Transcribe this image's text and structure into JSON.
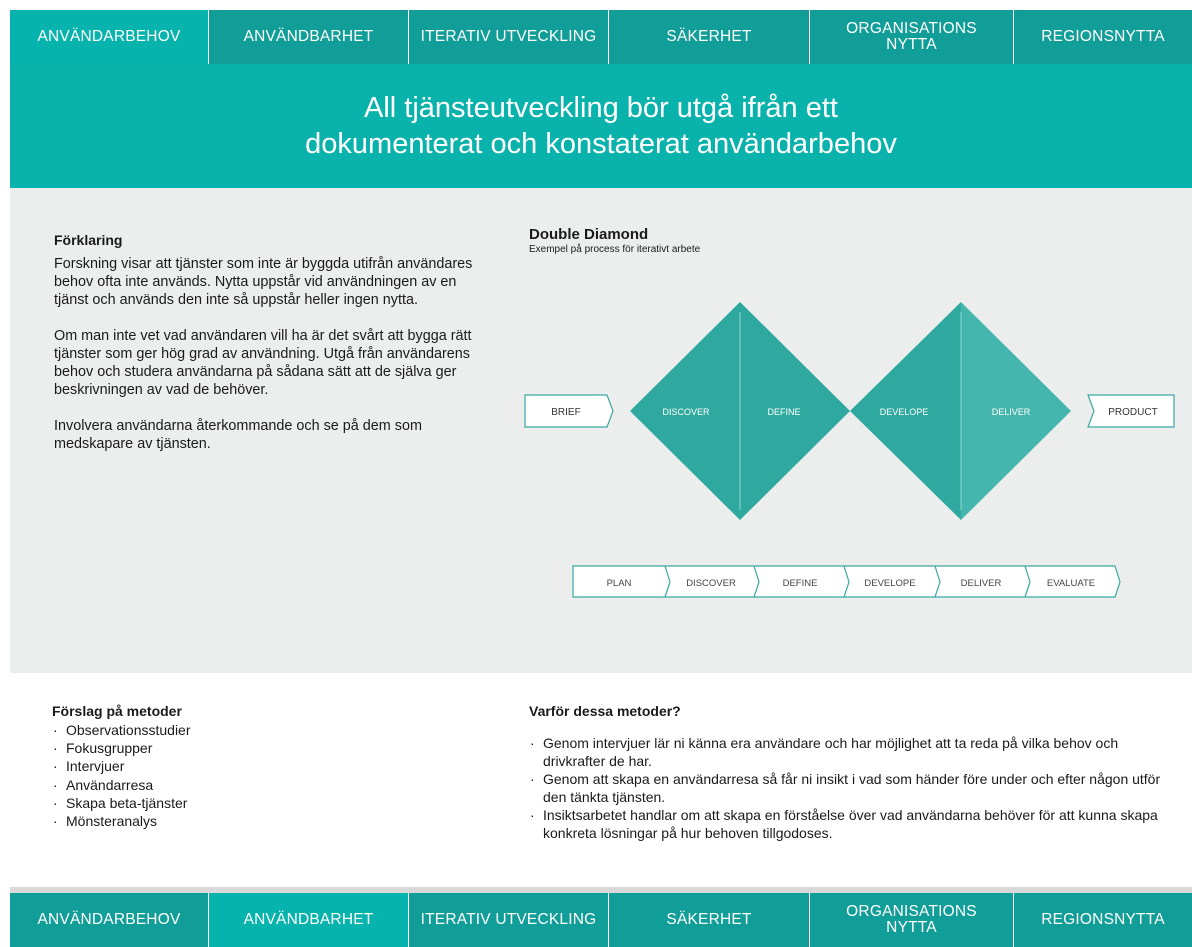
{
  "nav_top": [
    {
      "label": "ANVÄNDARBEHOV",
      "lines": [
        "ANVÄNDARBEHOV"
      ]
    },
    {
      "label": "ANVÄNDBARHET",
      "lines": [
        "ANVÄNDBARHET"
      ]
    },
    {
      "label": "ITERATIV UTVECKLING",
      "lines": [
        "ITERATIV UTVECKLING"
      ]
    },
    {
      "label": "SÄKERHET",
      "lines": [
        "SÄKERHET"
      ]
    },
    {
      "label": "ORGANISATIONS NYTTA",
      "lines": [
        "ORGANISATIONS",
        "NYTTA"
      ]
    },
    {
      "label": "REGIONSNYTTA",
      "lines": [
        "REGIONSNYTTA"
      ]
    }
  ],
  "hero": {
    "line1": "All tjänsteutveckling bör utgå ifrån ett",
    "line2": "dokumenterat och konstaterat användarbehov"
  },
  "explanation": {
    "heading": "Förklaring",
    "p1": "Forskning visar att tjänster som inte är byggda utifrån användares behov ofta inte används. Nytta uppstår vid användningen av en tjänst och används den inte så uppstår heller ingen nytta.",
    "p2": "Om man inte vet vad användaren vill ha är det svårt att bygga rätt tjänster som ger hög grad av användning. Utgå från användarens behov och studera användarna på sådana sätt att de själva ger beskrivningen av vad de behöver.",
    "p3": "Involvera användarna återkommande och se på dem som medskapare av tjänsten."
  },
  "diagram": {
    "title": "Double Diamond",
    "subtitle": "Exempel på process för iterativt arbete",
    "brief": "BRIEF",
    "product": "PRODUCT",
    "diamond_labels": [
      "DISCOVER",
      "DEFINE",
      "DEVELOPE",
      "DELIVER"
    ],
    "steps": [
      "PLAN",
      "DISCOVER",
      "DEFINE",
      "DEVELOPE",
      "DELIVER",
      "EVALUATE"
    ],
    "colors": {
      "diamond": "#2fa99f",
      "diamond_light": "#45b6ad",
      "outline": "#3aa7a3"
    }
  },
  "methods": {
    "heading": "Förslag på metoder",
    "items": [
      "Observationsstudier",
      "Fokusgrupper",
      "Intervjuer",
      "Användarresa",
      "Skapa beta-tjänster",
      "Mönsteranalys"
    ]
  },
  "why": {
    "heading": "Varför dessa metoder?",
    "items": [
      "Genom intervjuer lär ni känna era användare och har möjlighet att ta reda på vilka behov och drivkrafter de har.",
      "Genom att skapa en användarresa så får ni insikt i vad som händer före under och efter någon utför den tänkta tjänsten.",
      "Insiktsarbetet handlar om att skapa en förståelse över vad användarna behöver för att kunna skapa konkreta lösningar på hur behoven tillgodoses."
    ]
  },
  "nav_bottom": [
    {
      "label": "ANVÄNDARBEHOV",
      "lines": [
        "ANVÄNDARBEHOV"
      ]
    },
    {
      "label": "ANVÄNDBARHET",
      "lines": [
        "ANVÄNDBARHET"
      ]
    },
    {
      "label": "ITERATIV UTVECKLING",
      "lines": [
        "ITERATIV UTVECKLING"
      ]
    },
    {
      "label": "SÄKERHET",
      "lines": [
        "SÄKERHET"
      ]
    },
    {
      "label": "ORGANISATIONS NYTTA",
      "lines": [
        "ORGANISATIONS",
        "NYTTA"
      ]
    },
    {
      "label": "REGIONSNYTTA",
      "lines": [
        "REGIONSNYTTA"
      ]
    }
  ],
  "colors": {
    "nav": "#129e98",
    "nav_active": "#07b3ad",
    "hero": "#0ab2ac",
    "panel": "#eceeee"
  }
}
